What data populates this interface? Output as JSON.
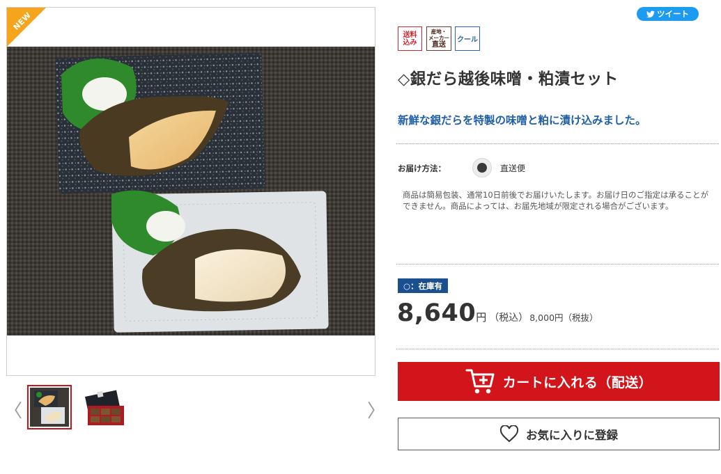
{
  "gallery": {
    "new_label": "NEW",
    "prev_arrow": "〈",
    "next_arrow": "〉",
    "thumbnails": [
      {
        "name": "thumbnail-dish",
        "selected": true
      },
      {
        "name": "thumbnail-package",
        "selected": false
      }
    ]
  },
  "share": {
    "tweet_label": "ツイート",
    "icon": "twitter-bird-icon",
    "color": "#1d9bf0"
  },
  "badges": {
    "shipping_included": [
      "送料",
      "込み"
    ],
    "direct_from_producer": [
      "産地・",
      "メーカー",
      "直送"
    ],
    "cool": "クール"
  },
  "product": {
    "title": "◇銀だら越後味噌・粕漬セット",
    "catchcopy": "新鮮な銀だらを特製の味噌と粕に漬け込みました。"
  },
  "delivery": {
    "label": "お届け方法：",
    "option": "直送便",
    "note": "商品は簡易包装、通常10日前後でお届けいたします。お届け日のご指定は承ることができません。商品によっては、お届先地域が限定される場合がございます。"
  },
  "stock": {
    "label": "○：在庫有",
    "color": "#1a4f90"
  },
  "price": {
    "amount": "8,640",
    "yen": "円",
    "tax_included": "（税込）",
    "tax_excluded": "8,000円（税抜）"
  },
  "actions": {
    "cart_label": "カートに入れる（配送）",
    "cart_color": "#d1151b",
    "favorite_label": "お気に入りに登録"
  }
}
